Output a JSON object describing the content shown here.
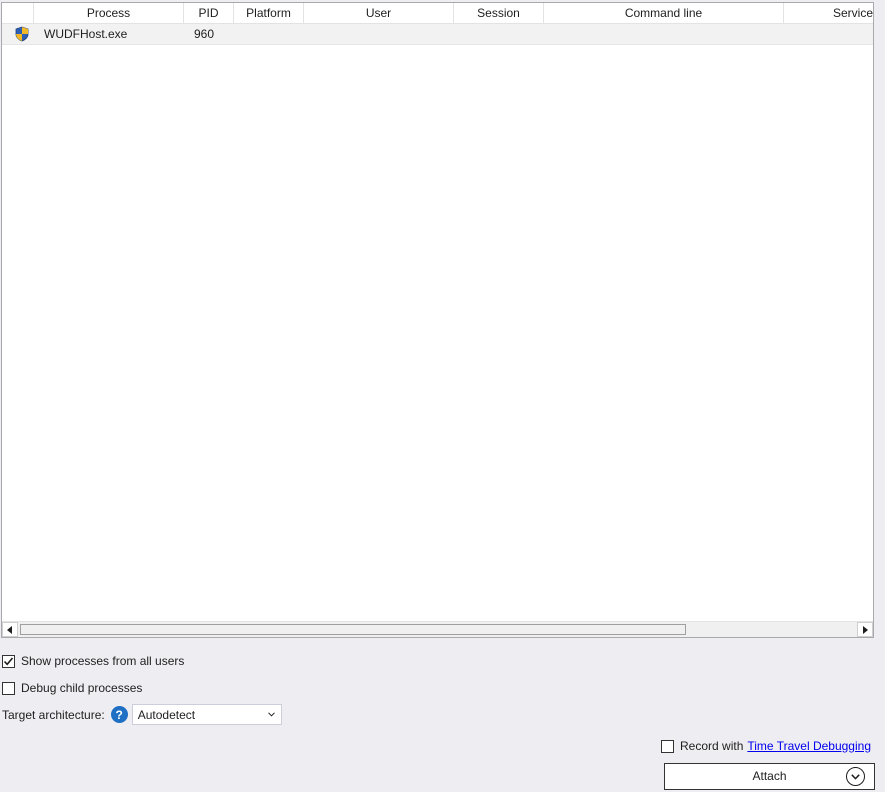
{
  "table": {
    "columns": [
      {
        "label": ""
      },
      {
        "label": "Process"
      },
      {
        "label": "PID"
      },
      {
        "label": "Platform"
      },
      {
        "label": "User"
      },
      {
        "label": "Session"
      },
      {
        "label": "Command line"
      },
      {
        "label": "Service"
      }
    ],
    "rows": [
      {
        "icon": "uac-shield-icon",
        "process": "WUDFHost.exe",
        "pid": "960",
        "platform": "",
        "user": "",
        "session": "",
        "command_line": "",
        "service": ""
      }
    ]
  },
  "options": {
    "show_all_users": {
      "label": "Show processes from all users",
      "checked": true
    },
    "debug_child": {
      "label": "Debug child processes",
      "checked": false
    }
  },
  "architecture": {
    "label": "Target architecture:",
    "help_icon": "help-question-icon",
    "selected": "Autodetect"
  },
  "record": {
    "label": "Record with",
    "link_text": "Time Travel Debugging",
    "checked": false
  },
  "attach_button": {
    "label": "Attach",
    "icon": "chevron-down-circle-icon"
  },
  "colors": {
    "background": "#eeedf2",
    "link": "#0000ee",
    "help_icon": "#1f6fc5"
  }
}
